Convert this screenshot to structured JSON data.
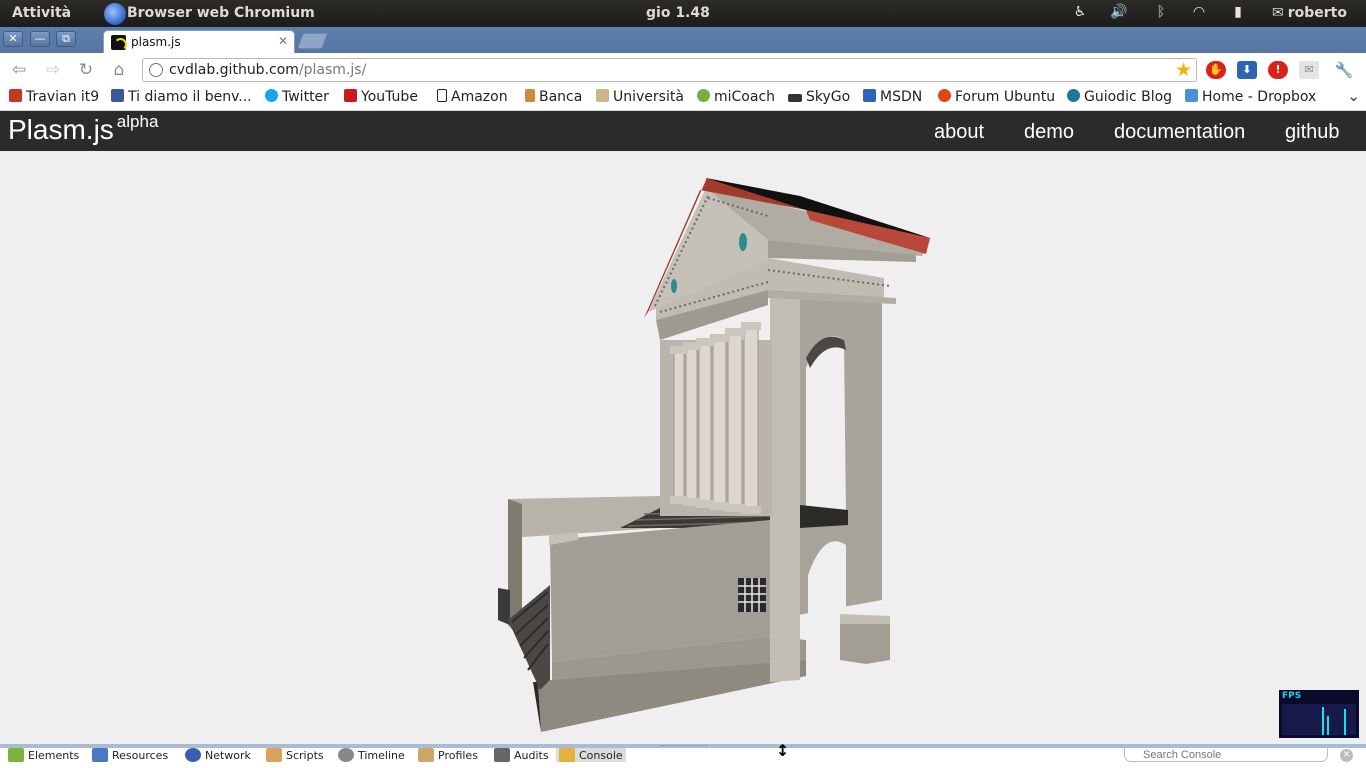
{
  "top_panel": {
    "activities": "Attività",
    "app_name": "Browser web Chromium",
    "clock": "gio  1.48",
    "user": "roberto",
    "tray_icons": [
      "accessibility-icon",
      "volume-icon",
      "bluetooth-icon",
      "wifi-icon",
      "battery-icon",
      "mail-icon"
    ]
  },
  "window": {
    "close": "✕",
    "minimize": "—",
    "maximize": "⧉"
  },
  "tab": {
    "title": "plasm.js",
    "close": "✕"
  },
  "toolbar": {
    "url_host": "cvdlab.github.com",
    "url_path": "/plasm.js/",
    "extensions": [
      "adblock-icon",
      "download-icon",
      "alert-icon",
      "gmail-icon",
      "wrench-icon"
    ]
  },
  "bookmarks": [
    {
      "label": "Travian it9",
      "color": "#c0392b"
    },
    {
      "label": "Ti diamo il benv...",
      "color": "#3b5998"
    },
    {
      "label": "Twitter",
      "color": "#1da1f2"
    },
    {
      "label": "YouTube",
      "color": "#cc181e"
    },
    {
      "label": "Amazon",
      "color": "#222222"
    },
    {
      "label": "Banca",
      "color": "#c98b3c"
    },
    {
      "label": "Università",
      "color": "#c9b78a"
    },
    {
      "label": "miCoach",
      "color": "#6db33f"
    },
    {
      "label": "SkyGo",
      "color": "#333333"
    },
    {
      "label": "MSDN",
      "color": "#2f63b5"
    },
    {
      "label": "Forum Ubuntu",
      "color": "#dd4814"
    },
    {
      "label": "Guiodic Blog",
      "color": "#21759b"
    },
    {
      "label": "Home - Dropbox",
      "color": "#4a90d9"
    }
  ],
  "site": {
    "brand": "Plasm.js",
    "brand_sup": "alpha",
    "nav": [
      "about",
      "demo",
      "documentation",
      "github"
    ]
  },
  "fps": {
    "label": "FPS",
    "bars": [
      0.9,
      0.6,
      0.85
    ]
  },
  "devtools": {
    "tabs": [
      "Elements",
      "Resources",
      "Network",
      "Scripts",
      "Timeline",
      "Profiles",
      "Audits",
      "Console"
    ],
    "active_tab": "Console",
    "search_placeholder": "Search Console"
  },
  "colors": {
    "site_header_bg": "#2b2b2b",
    "temple_stone": "#a8a39b",
    "temple_roof": "#a23b2c",
    "chrome_frame": "#5a79a6"
  }
}
